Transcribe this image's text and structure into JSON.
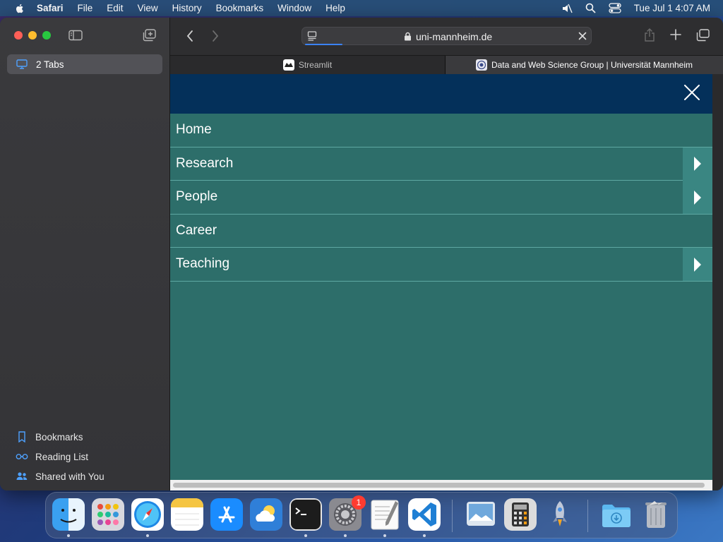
{
  "menubar": {
    "app": "Safari",
    "items": [
      "File",
      "Edit",
      "View",
      "History",
      "Bookmarks",
      "Window",
      "Help"
    ],
    "clock": "Tue Jul 1  4:07 AM"
  },
  "sidebar": {
    "tab_group_label": "2 Tabs",
    "bottom": [
      {
        "label": "Bookmarks",
        "icon": "bookmark-icon"
      },
      {
        "label": "Reading List",
        "icon": "reading-list-icon"
      },
      {
        "label": "Shared with You",
        "icon": "shared-with-you-icon"
      }
    ]
  },
  "toolbar": {
    "url": "uni-mannheim.de"
  },
  "tabs": [
    {
      "title": "Streamlit",
      "active": false
    },
    {
      "title": "Data and Web Science Group | Universität Mannheim",
      "active": true
    }
  ],
  "page": {
    "header_color": "#04305a",
    "menu_bg": "#2d6e6a",
    "menu": [
      {
        "label": "Home",
        "has_submenu": false
      },
      {
        "label": "Research",
        "has_submenu": true
      },
      {
        "label": "People",
        "has_submenu": true
      },
      {
        "label": "Career",
        "has_submenu": false
      },
      {
        "label": "Teaching",
        "has_submenu": true
      }
    ]
  },
  "dock": {
    "apps": [
      "Finder",
      "Launchpad",
      "Safari",
      "Notes",
      "App Store",
      "Weather",
      "Terminal",
      "System Settings",
      "TextEdit",
      "Visual Studio Code",
      "Preview",
      "Calculator",
      "Rocket",
      "Downloads",
      "Trash"
    ],
    "settings_badge": "1"
  }
}
